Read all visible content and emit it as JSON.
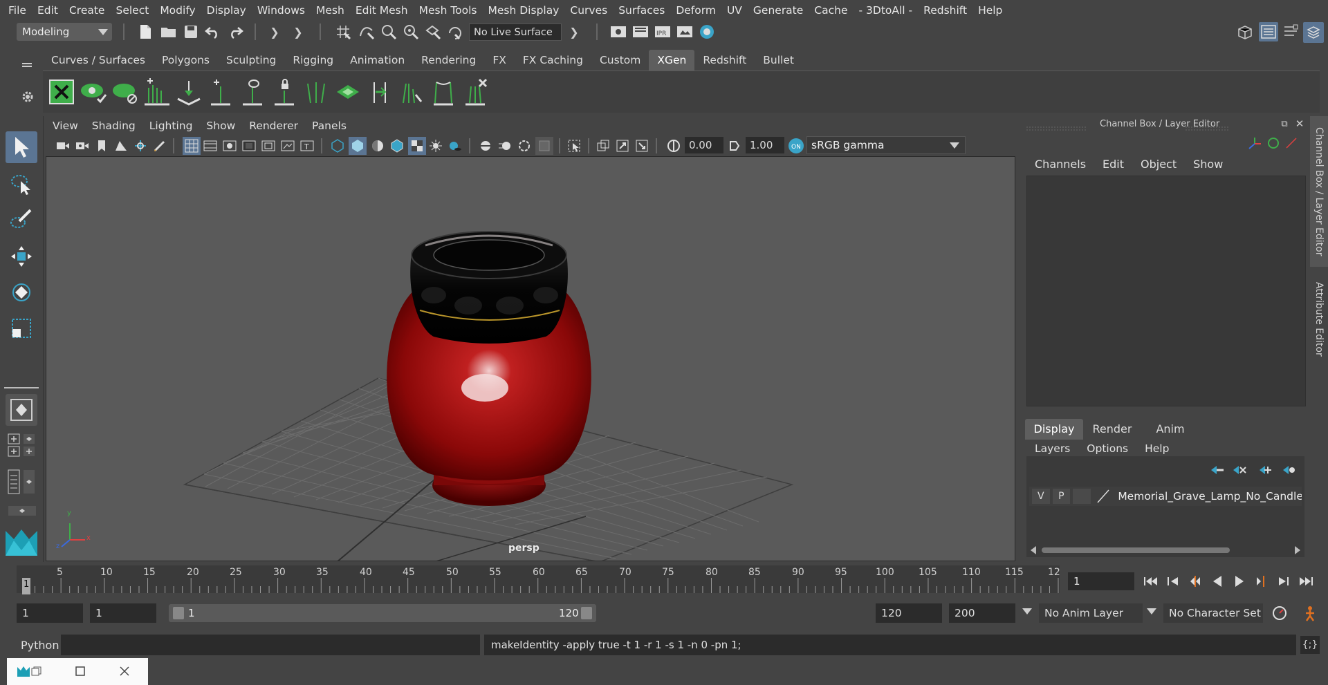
{
  "menubar": {
    "items": [
      "File",
      "Edit",
      "Create",
      "Select",
      "Modify",
      "Display",
      "Windows",
      "Mesh",
      "Edit Mesh",
      "Mesh Tools",
      "Mesh Display",
      "Curves",
      "Surfaces",
      "Deform",
      "UV",
      "Generate",
      "Cache",
      "- 3DtoAll -",
      "Redshift",
      "Help"
    ]
  },
  "statusline": {
    "mode": "Modeling",
    "live_surface": "No Live Surface"
  },
  "shelf": {
    "tabs": [
      "Curves / Surfaces",
      "Polygons",
      "Sculpting",
      "Rigging",
      "Animation",
      "Rendering",
      "FX",
      "FX Caching",
      "Custom",
      "XGen",
      "Redshift",
      "Bullet"
    ],
    "active_tab": "XGen"
  },
  "viewport": {
    "menu": [
      "View",
      "Shading",
      "Lighting",
      "Show",
      "Renderer",
      "Panels"
    ],
    "exposure": "0.00",
    "gamma": "1.00",
    "color_space": "sRGB gamma",
    "camera_label": "persp",
    "axis_labels": {
      "x": "x",
      "y": "y",
      "z": "z"
    }
  },
  "channelbox": {
    "title": "Channel Box / Layer Editor",
    "menu": [
      "Channels",
      "Edit",
      "Object",
      "Show"
    ]
  },
  "layereditor": {
    "tabs": [
      "Display",
      "Render",
      "Anim"
    ],
    "active_tab": "Display",
    "menu": [
      "Layers",
      "Options",
      "Help"
    ],
    "layer": {
      "v": "V",
      "p": "P",
      "name": "Memorial_Grave_Lamp_No_Candle_R"
    }
  },
  "side_tabs": {
    "channel_box": "Channel Box / Layer Editor",
    "attribute_editor": "Attribute Editor"
  },
  "timeslider": {
    "ticks": [
      "1",
      "5",
      "10",
      "15",
      "20",
      "25",
      "30",
      "35",
      "40",
      "45",
      "50",
      "55",
      "60",
      "65",
      "70",
      "75",
      "80",
      "85",
      "90",
      "95",
      "100",
      "105",
      "110",
      "115",
      "12"
    ],
    "current_frame": "1"
  },
  "range": {
    "start": "1",
    "inner_start": "1",
    "slider_start": "1",
    "slider_end": "120",
    "end": "120",
    "outer_end": "200",
    "anim_layer": "No Anim Layer",
    "character_set": "No Character Set"
  },
  "commandline": {
    "language": "Python",
    "output": "makeIdentity -apply true -t 1 -r 1 -s 1 -n 0 -pn 1;"
  },
  "colors": {
    "accent_blue": "#5b7593",
    "object_red": "#b01010",
    "xgen_green": "#3fae4a"
  }
}
